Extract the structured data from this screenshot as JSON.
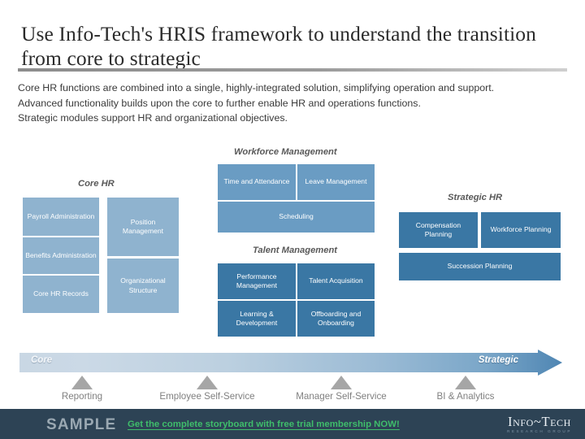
{
  "slide": {
    "title": "Use Info-Tech's HRIS framework to understand the transition from core to strategic",
    "body_lines": [
      "Core HR functions are combined into a single, highly-integrated solution, simplifying operation and support.",
      "Advanced functionality builds upon the core to further enable HR and operations functions.",
      "Strategic modules support HR and organizational objectives."
    ]
  },
  "captions": {
    "core_hr": "Core HR",
    "workforce_management": "Workforce Management",
    "talent_management": "Talent Management",
    "strategic_hr": "Strategic HR"
  },
  "modules": {
    "core_hr": [
      "Payroll Administration",
      "Benefits Administration",
      "Core HR Records",
      "Position Management",
      "Organizational Structure"
    ],
    "workforce_management": [
      "Time and Attendance",
      "Leave Management",
      "Scheduling"
    ],
    "talent_management": [
      "Performance Management",
      "Talent Acquisition",
      "Learning & Development",
      "Offboarding and Onboarding"
    ],
    "strategic_hr": [
      "Compensation Planning",
      "Workforce Planning",
      "Succession Planning"
    ]
  },
  "arrow": {
    "left_label": "Core",
    "right_label": "Strategic"
  },
  "cross_cutting": [
    "Reporting",
    "Employee Self-Service",
    "Manager Self-Service",
    "BI & Analytics"
  ],
  "footer": {
    "sample_watermark": "SAMPLE",
    "promo_text": "Get the complete storyboard with free trial membership NOW!",
    "logo_name": "Info~Tech",
    "logo_tagline": "RESEARCH GROUP"
  },
  "colors": {
    "core_box": "#8fb3cf",
    "workforce_box": "#6a9cc3",
    "dark_box": "#3a77a4",
    "footer_bg": "#2d4355",
    "promo_green": "#3fbd6b",
    "caption_gray": "#595959"
  }
}
